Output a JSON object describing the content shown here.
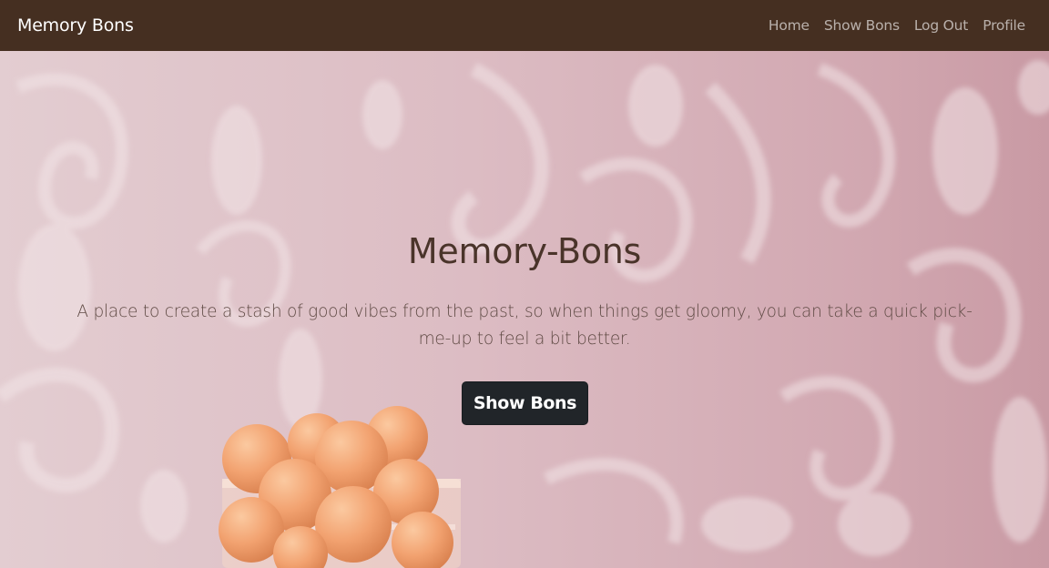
{
  "navbar": {
    "brand": "Memory Bons",
    "links": [
      {
        "label": "Home"
      },
      {
        "label": "Show Bons"
      },
      {
        "label": "Log Out"
      },
      {
        "label": "Profile"
      }
    ],
    "background": "#452f21"
  },
  "hero": {
    "title": "Memory-Bons",
    "description": "A place to create a stash of good vibes from the past, so when things get gloomy, you can take a quick pick-me-up to feel a bit better.",
    "button_label": "Show Bons",
    "background_image": "pink damask wallpaper with a glass bowl of orange candy balls",
    "accent": "#e8a070"
  }
}
